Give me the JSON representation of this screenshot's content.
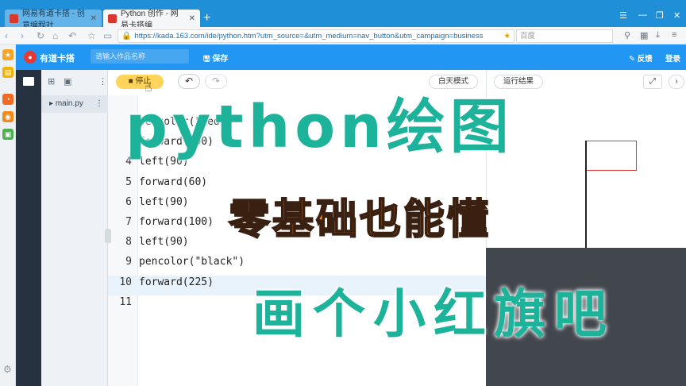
{
  "browser": {
    "tabs": [
      {
        "title": "网易有道卡搭 - 创意编程社"
      },
      {
        "title": "Python 创作 - 网易卡搭编"
      }
    ],
    "new_tab": "+",
    "url": "https://kada.163.com/ide/python.htm?utm_source=&utm_medium=nav_button&utm_campaign=business",
    "search_placeholder": "百度"
  },
  "app": {
    "name": "有道卡搭",
    "work_name_placeholder": "请输入作品名称",
    "save_label": "保存",
    "feedback_label": "反馈",
    "login_label": "登录",
    "file_name": "main.py"
  },
  "editor": {
    "stop_label": "停止",
    "day_mode_label": "白天模式",
    "lines": [
      {
        "num": "",
        "text": "pencolor(\"red\")"
      },
      {
        "num": "",
        "text": "forward(100)"
      },
      {
        "num": "4",
        "text": "left(90)"
      },
      {
        "num": "5",
        "text": "forward(60)"
      },
      {
        "num": "6",
        "text": "left(90)"
      },
      {
        "num": "7",
        "text": "forward(100)"
      },
      {
        "num": "8",
        "text": "left(90)"
      },
      {
        "num": "9",
        "text": "pencolor(\"black\")"
      },
      {
        "num": "10",
        "text": "forward(225)"
      },
      {
        "num": "11",
        "text": ""
      }
    ],
    "active_line": "10"
  },
  "output": {
    "label": "运行结果"
  },
  "overlay": {
    "title": "python绘图",
    "subtitle": "零基础也能懂",
    "tagline": "画个小红旗吧"
  },
  "colors": {
    "browser_blue": "#1f8fd8",
    "app_blue": "#2196f3",
    "rail_dark": "#273240",
    "caption_teal": "#1db39a",
    "caption_orange": "#f28a2a",
    "flag_red": "#e53935"
  }
}
